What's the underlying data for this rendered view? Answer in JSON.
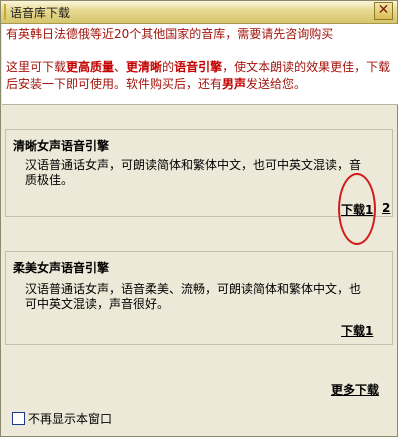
{
  "window": {
    "title": "语音库下载",
    "close_glyph": "✕"
  },
  "notice": {
    "line1": "有英韩日法德俄等近20个其他国家的音库，需要请先咨询购买",
    "line2": {
      "p1": "这里可下载",
      "bold1": "更高质量",
      "sep": "、",
      "bold2": "更清晰",
      "p2": "的",
      "bold3": "语音引擎",
      "p3": "，使文本朗读的效果更佳，下载后安装一下即可使用。软件购买后，还有",
      "bold4": "男声",
      "p4": "发送给您。"
    }
  },
  "engines": [
    {
      "title": "清晰女声语音引擎",
      "description": "汉语普通话女声，可朗读简体和繁体中文，也可中英文混读，音质极佳。",
      "links": [
        "下载1",
        "2"
      ]
    },
    {
      "title": "柔美女声语音引擎",
      "description": "汉语普通话女声，语音柔美、流畅，可朗读简体和繁体中文，也可中英文混读，声音很好。",
      "links": [
        "下载1"
      ]
    }
  ],
  "more_download": "更多下载",
  "dont_show": {
    "label": "不再显示本窗口",
    "checked": false
  },
  "colors": {
    "annotation_circle": "#d21a1a",
    "notice_text": "#a2140c"
  }
}
